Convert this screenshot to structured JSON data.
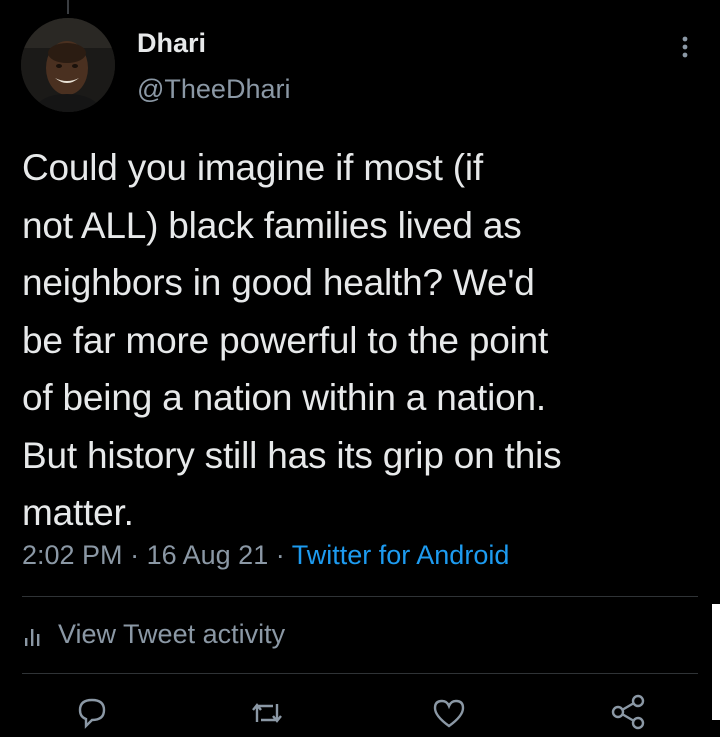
{
  "author": {
    "display_name": "Dhari",
    "handle": "@TheeDhari"
  },
  "tweet": {
    "text": "Could you imagine if most (if\nnot ALL) black families lived as\nneighbors in good health? We'd\nbe far more powerful to the point\nof being a nation within a nation.\nBut history still has its grip on this\nmatter.",
    "time": "2:02 PM",
    "separator": "·",
    "date": "16 Aug 21",
    "source": "Twitter for Android"
  },
  "activity": {
    "label": "View Tweet activity",
    "icon": "bar-chart-icon"
  },
  "actions": [
    {
      "icon": "reply-icon"
    },
    {
      "icon": "retweet-icon"
    },
    {
      "icon": "heart-icon"
    },
    {
      "icon": "share-icon"
    }
  ],
  "colors": {
    "background": "#000000",
    "primary_text": "#e7e9ea",
    "secondary_text": "#8b98a5",
    "link": "#1d9bf0",
    "divider": "#2f3336"
  }
}
